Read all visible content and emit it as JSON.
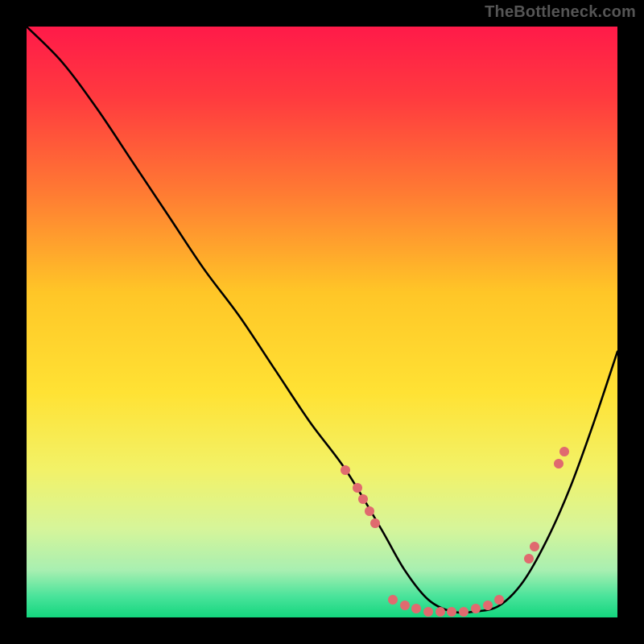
{
  "watermark": "TheBottleneck.com",
  "accent_marker_color": "#e06a6f",
  "curve_color": "#000000",
  "chart_data": {
    "type": "line",
    "title": "",
    "xlabel": "",
    "ylabel": "",
    "xlim": [
      0,
      100
    ],
    "ylim": [
      0,
      100
    ],
    "grid": false,
    "gradient_stops": [
      {
        "pos": 0.0,
        "color": "#ff1a49"
      },
      {
        "pos": 0.12,
        "color": "#ff3a3f"
      },
      {
        "pos": 0.28,
        "color": "#ff7a33"
      },
      {
        "pos": 0.45,
        "color": "#ffc627"
      },
      {
        "pos": 0.62,
        "color": "#ffe234"
      },
      {
        "pos": 0.75,
        "color": "#f2f268"
      },
      {
        "pos": 0.85,
        "color": "#d6f59a"
      },
      {
        "pos": 0.92,
        "color": "#a8efb1"
      },
      {
        "pos": 0.965,
        "color": "#48e39a"
      },
      {
        "pos": 1.0,
        "color": "#14d67e"
      }
    ],
    "series": [
      {
        "name": "bottleneck-curve",
        "x": [
          0,
          6,
          12,
          18,
          24,
          30,
          36,
          42,
          48,
          54,
          60,
          64,
          68,
          72,
          76,
          80,
          84,
          88,
          92,
          96,
          100
        ],
        "y": [
          100,
          94,
          86,
          77,
          68,
          59,
          51,
          42,
          33,
          25,
          15,
          8,
          3,
          1,
          1,
          2,
          6,
          13,
          22,
          33,
          45
        ]
      }
    ],
    "markers": [
      {
        "x": 54,
        "y": 25
      },
      {
        "x": 56,
        "y": 22
      },
      {
        "x": 57,
        "y": 20
      },
      {
        "x": 58,
        "y": 18
      },
      {
        "x": 59,
        "y": 16
      },
      {
        "x": 62,
        "y": 3
      },
      {
        "x": 64,
        "y": 2
      },
      {
        "x": 66,
        "y": 1.5
      },
      {
        "x": 68,
        "y": 1
      },
      {
        "x": 70,
        "y": 1
      },
      {
        "x": 72,
        "y": 1
      },
      {
        "x": 74,
        "y": 1
      },
      {
        "x": 76,
        "y": 1.5
      },
      {
        "x": 78,
        "y": 2
      },
      {
        "x": 80,
        "y": 3
      },
      {
        "x": 85,
        "y": 10
      },
      {
        "x": 86,
        "y": 12
      },
      {
        "x": 90,
        "y": 26
      },
      {
        "x": 91,
        "y": 28
      }
    ]
  }
}
